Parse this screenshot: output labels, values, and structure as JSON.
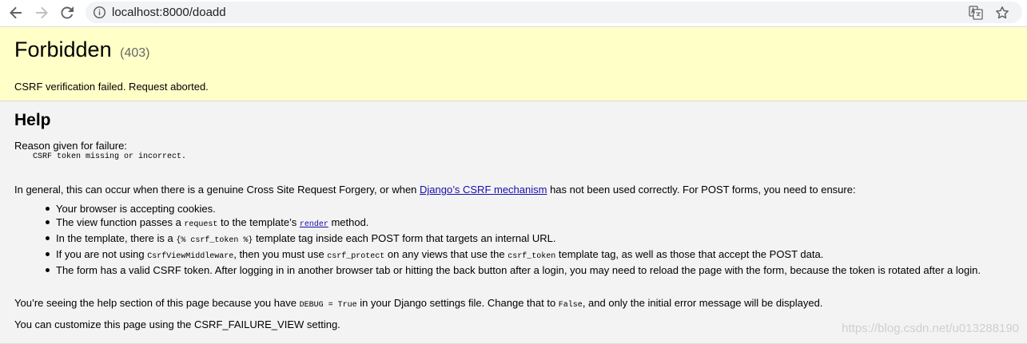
{
  "browser": {
    "url": "localhost:8000/doadd"
  },
  "page": {
    "title": "Forbidden",
    "status_code": "(403)",
    "message": "CSRF verification failed. Request aborted.",
    "help_heading": "Help",
    "reason_label": "Reason given for failure:",
    "reason": "CSRF token missing or incorrect.",
    "intro_before_link": "In general, this can occur when there is a genuine Cross Site Request Forgery, or when ",
    "intro_link": "Django’s CSRF mechanism",
    "intro_after_link": " has not been used correctly. For POST forms, you need to ensure:",
    "checklist": {
      "item1": "Your browser is accepting cookies.",
      "item2_pre": "The view function passes a ",
      "item2_code": "request",
      "item2_mid": " to the template’s ",
      "item2_link": "render",
      "item2_post": " method.",
      "item3_pre": "In the template, there is a ",
      "item3_code": "{% csrf_token %}",
      "item3_post": " template tag inside each POST form that targets an internal URL.",
      "item4_pre": "If you are not using ",
      "item4_code1": "CsrfViewMiddleware",
      "item4_mid": ", then you must use ",
      "item4_code2": "csrf_protect",
      "item4_mid2": " on any views that use the ",
      "item4_code3": "csrf_token",
      "item4_post": " template tag, as well as those that accept the POST data.",
      "item5": "The form has a valid CSRF token. After logging in in another browser tab or hitting the back button after a login, you may need to reload the page with the form, because the token is rotated after a login."
    },
    "debug_pre": "You’re seeing the help section of this page because you have ",
    "debug_code": "DEBUG = True",
    "debug_mid": " in your Django settings file. Change that to ",
    "debug_code2": "False",
    "debug_post": ", and only the initial error message will be displayed.",
    "customize": "You can customize this page using the CSRF_FAILURE_VIEW setting.",
    "watermark": "https://blog.csdn.net/u013288190"
  }
}
